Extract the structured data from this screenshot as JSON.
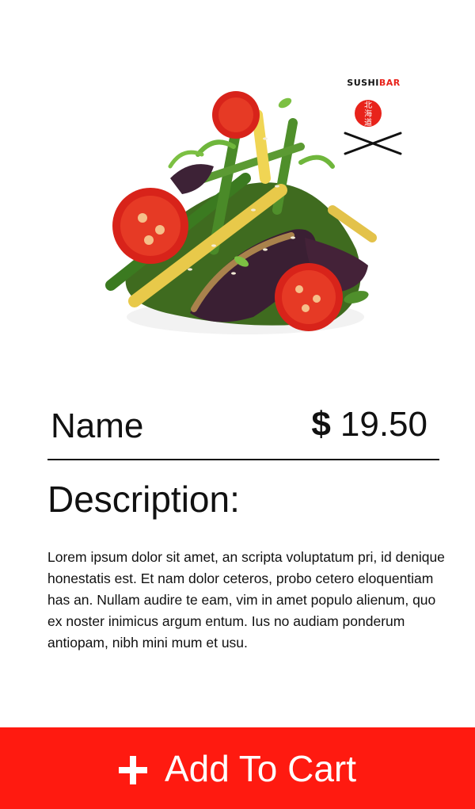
{
  "logo": {
    "brand_part1": "SUSHI",
    "brand_part2": "BAR",
    "seal_text": "北海道",
    "brand_accent": "#e8231b"
  },
  "product": {
    "name": "Name",
    "currency_symbol": "$",
    "price": "19.50",
    "image_icon": "salad-dish-image"
  },
  "description": {
    "heading": "Description:",
    "body": "Lorem ipsum dolor sit amet, an scripta voluptatum pri, id denique honestatis est. Et nam dolor ceteros, probo cetero eloquentiam has an. Nullam audire te eam, vim in amet populo alienum, quo ex noster inimicus argum entum. Ius no audiam ponderum antiopam, nibh mini mum et usu."
  },
  "cart_button": {
    "label": "Add To Cart",
    "icon": "plus-icon",
    "background": "#ff1a10",
    "text_color": "#ffffff"
  }
}
